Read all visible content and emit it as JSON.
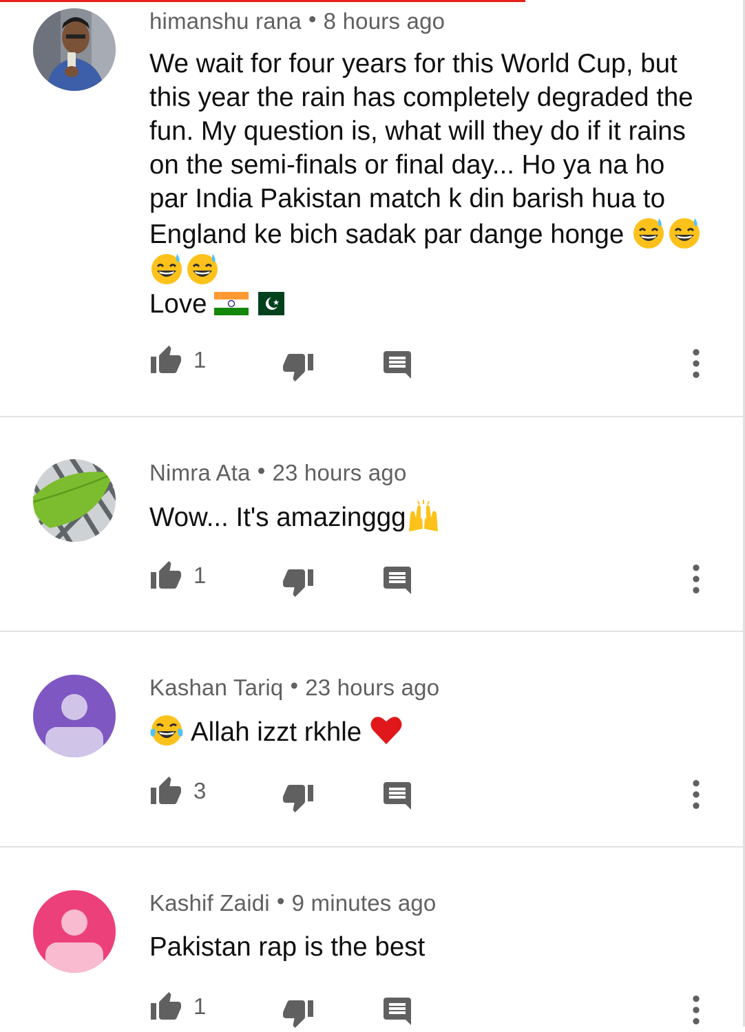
{
  "accent_color": "#e62117",
  "icon_color": "#606060",
  "icons": {
    "like": "thumb-up-icon",
    "dislike": "thumb-down-icon",
    "reply": "reply-icon",
    "more": "more-vert-icon"
  },
  "comments": [
    {
      "author": "himanshu rana",
      "separator": "•",
      "time": "8 hours ago",
      "text": "We wait for four years for this World Cup, but this year the rain has completely degraded the fun. My question is, what will they do if it rains on the semi-finals or final day... Ho ya na ho par India Pakistan match k din barish hua to England ke bich sadak par dange honge",
      "text_emoji": "😅😅😅😅",
      "line2_text": "Love",
      "line2_emoji": "🇮🇳🇵🇰",
      "likes": "1",
      "avatar": "photo-person-avatar"
    },
    {
      "author": "Nimra Ata",
      "separator": "•",
      "time": "23 hours ago",
      "text": "Wow... It's amazinggg",
      "text_emoji": "🙌",
      "likes": "1",
      "avatar": "photo-leaf-avatar"
    },
    {
      "author": "Kashan Tariq",
      "separator": "•",
      "time": "23 hours ago",
      "lead_emoji": "😂",
      "text": "Allah izzt rkhle",
      "text_emoji": "❤️",
      "likes": "3",
      "avatar": "default-avatar-purple",
      "avatar_color": "#7e57c2",
      "avatar_fg": "#d1c4e9"
    },
    {
      "author": "Kashif Zaidi",
      "separator": "•",
      "time": "9 minutes ago",
      "text": "Pakistan rap is the best",
      "likes": "1",
      "avatar": "default-avatar-pink",
      "avatar_color": "#ec407a",
      "avatar_fg": "#f8bbd0"
    }
  ]
}
